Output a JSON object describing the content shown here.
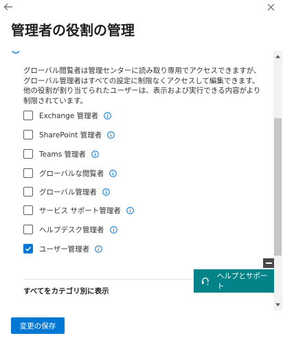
{
  "panel": {
    "title": "管理者の役割の管理",
    "back_icon": "arrow-left-icon",
    "close_icon": "close-icon"
  },
  "roles": {
    "description": "グローバル閲覧者は管理センターに読み取り専用でアクセスできますが、グローバル管理者はすべての設定に制限なくアクセスして編集できます。他の役割が割り当てられたユーザーは、表示および実行できる内容がより制限されています。",
    "items": [
      {
        "label": "Exchange 管理者",
        "checked": false
      },
      {
        "label": "SharePoint 管理者",
        "checked": false
      },
      {
        "label": "Teams 管理者",
        "checked": false
      },
      {
        "label": "グローバルな閲覧者",
        "checked": false
      },
      {
        "label": "グローバル管理者",
        "checked": false
      },
      {
        "label": "サービス サポート管理者",
        "checked": false
      },
      {
        "label": "ヘルプデスク管理者",
        "checked": false
      },
      {
        "label": "ユーザー管理者",
        "checked": true
      }
    ],
    "show_all_link": "すべてをカテゴリ別に表示"
  },
  "help": {
    "label": "ヘルプとサポート",
    "icon": "headset-icon",
    "minimize_icon": "minimize-icon"
  },
  "footer": {
    "save_label": "変更の保存"
  },
  "colors": {
    "accent": "#0078d4",
    "help_bg": "#038387",
    "info_icon": "#0078d4"
  }
}
